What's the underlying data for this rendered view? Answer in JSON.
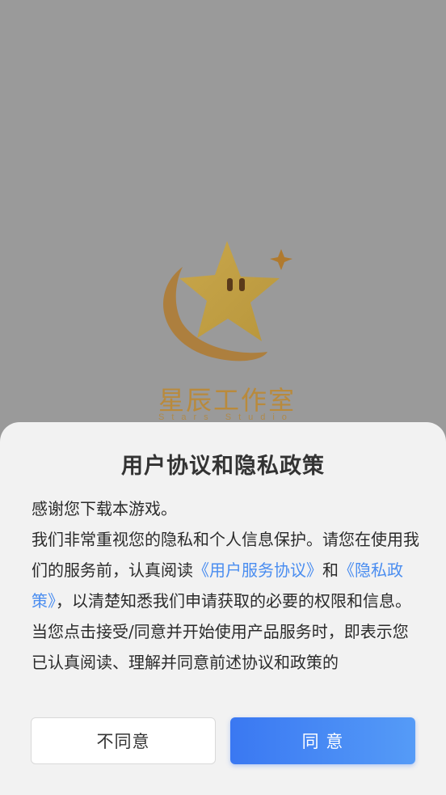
{
  "splash": {
    "logo_title": "星辰工作室",
    "logo_subtitle": "Stars Studio"
  },
  "dialog": {
    "title": "用户协议和隐私政策",
    "paragraph1": "感谢您下载本游戏。",
    "paragraph2_part1": "我们非常重视您的隐私和个人信息保护。请您在使用我们的服务前，认真阅读",
    "user_agreement_link": "《用户服务协议》",
    "paragraph2_and": "和",
    "privacy_policy_link": "《隐私政策》",
    "paragraph2_part2": "，以清楚知悉我们申请获取的必要的权限和信息。",
    "paragraph3": "当您点击接受/同意并开始使用产品服务时，即表示您已认真阅读、理解并同意前述协议和政策的",
    "disagree_label": "不同意",
    "agree_label": "同 意"
  },
  "colors": {
    "overlay": "#9a9a9a",
    "link": "#4a8df0",
    "agree_start": "#3a78f2",
    "agree_end": "#559bf7",
    "logo": "#c9a74b"
  }
}
